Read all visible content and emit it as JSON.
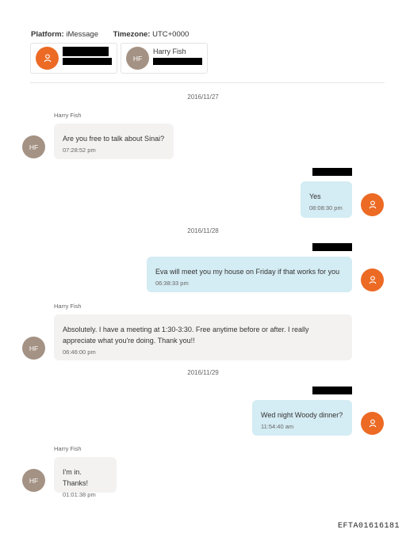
{
  "header": {
    "platform_label": "Platform:",
    "platform_value": "iMessage",
    "timezone_label": "Timezone:",
    "timezone_value": "UTC+0000"
  },
  "participants": [
    {
      "initials": "",
      "name": "",
      "avatar_color": "#ec6a24",
      "icon": "person-icon"
    },
    {
      "initials": "HF",
      "name": "Harry Fish",
      "avatar_color": "#a49284"
    }
  ],
  "dates": [
    "2016/11/27",
    "2016/11/28",
    "2016/11/29"
  ],
  "messages": [
    {
      "direction": "incoming",
      "sender": "Harry Fish",
      "initials": "HF",
      "text": "Are you free to talk about Sinai?",
      "time": "07:28:52 pm"
    },
    {
      "direction": "outgoing",
      "text": "Yes",
      "time": "08:08:30 pm"
    },
    {
      "direction": "outgoing",
      "text": "Eva will meet you my house on Friday if that works for you",
      "time": "06:38:33 pm"
    },
    {
      "direction": "incoming",
      "sender": "Harry Fish",
      "initials": "HF",
      "text": "Absolutely. I have a meeting at 1:30-3:30. Free anytime before or after. I really appreciate what you're doing. Thank you!!",
      "time": "06:46:00 pm"
    },
    {
      "direction": "outgoing",
      "text": "Wed night Woody dinner?",
      "time": "11:54:40 am"
    },
    {
      "direction": "incoming",
      "sender": "Harry Fish",
      "initials": "HF",
      "text": "I'm in. Thanks!",
      "time": "01:01:38 pm"
    }
  ],
  "colors": {
    "incoming_bubble": "#f4f2f1",
    "outgoing_bubble": "#d4ecf3",
    "owner_avatar": "#ec6a24",
    "contact_avatar": "#a49284",
    "redaction": "#000000"
  },
  "footer": {
    "doc_id": "EFTA01616181"
  }
}
